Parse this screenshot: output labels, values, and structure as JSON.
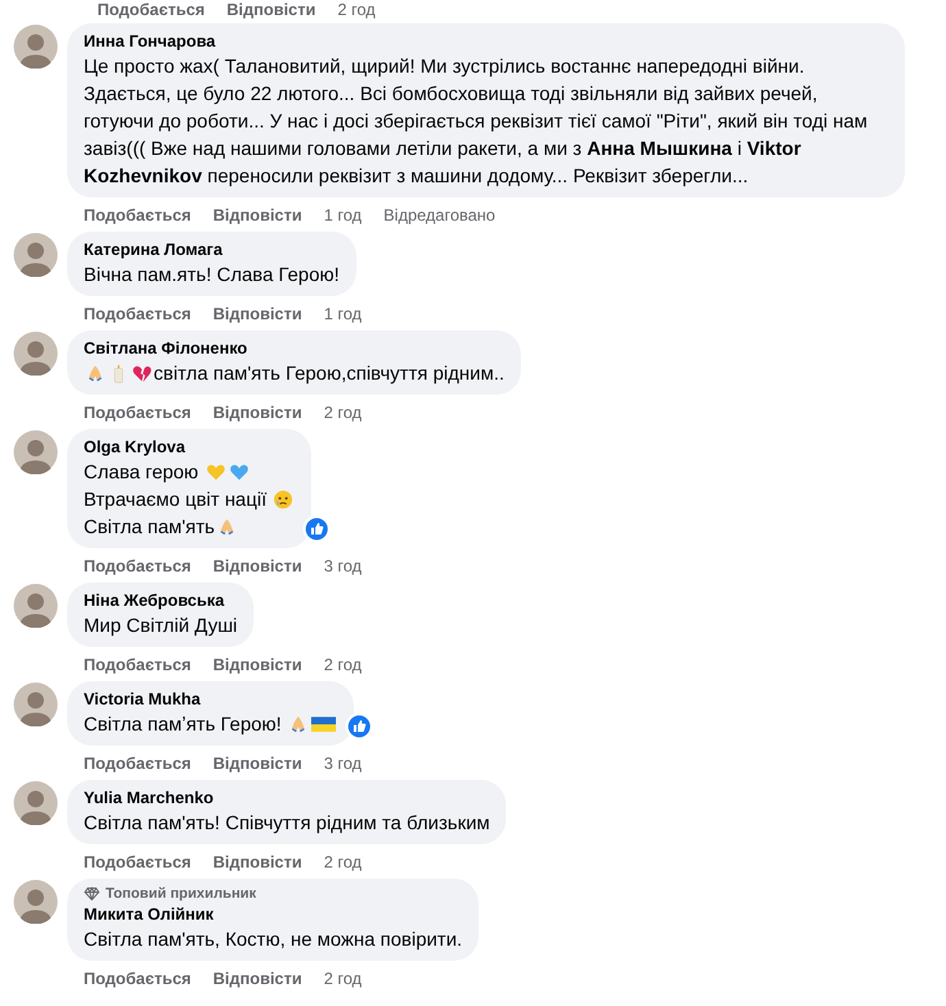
{
  "top_actions": {
    "like": "Подобається",
    "reply": "Відповісти",
    "time": "2 год"
  },
  "comments": [
    {
      "author": "Инна Гончарова",
      "lines": [
        [
          {
            "kind": "text",
            "text": "Це просто жах( Талановитий, щирий! Ми зустрілись востаннє напередодні війни. Здається, це було 22 лютого... Всі бомбосховища тоді звільняли від зайвих речей, готуючи до роботи... У нас і досі зберігається реквізит тієї самої \"Ріти\", який він тоді нам завіз((( Вже над нашими головами летіли ракети, а ми з **Анна Мышкина** і **Viktor Kozhevnikov** переносили реквізит з машини додому... Реквізит зберегли..."
          }
        ]
      ],
      "liked": false,
      "like": "Подобається",
      "reply": "Відповісти",
      "time": "1 год",
      "edited": "Відредаговано"
    },
    {
      "author": "Катерина Ломага",
      "lines": [
        [
          {
            "kind": "text",
            "text": "Вічна пам.ять! Слава Герою!"
          }
        ]
      ],
      "liked": false,
      "like": "Подобається",
      "reply": "Відповісти",
      "time": "1 год"
    },
    {
      "author": "Світлана Філоненко",
      "lines": [
        [
          {
            "kind": "pray"
          },
          {
            "kind": "candle"
          },
          {
            "kind": "broken-heart"
          },
          {
            "kind": "text",
            "text": "світла пам'ять Герою,співчуття рідним.."
          }
        ]
      ],
      "liked": false,
      "like": "Подобається",
      "reply": "Відповісти",
      "time": "2 год"
    },
    {
      "author": "Olga Krylova",
      "lines": [
        [
          {
            "kind": "text",
            "text": "Слава герою "
          },
          {
            "kind": "heart",
            "color": "#f7c325"
          },
          {
            "kind": "heart",
            "color": "#4aa8f0"
          }
        ],
        [
          {
            "kind": "text",
            "text": "Втрачаємо цвіт нації "
          },
          {
            "kind": "sad-face"
          }
        ],
        [
          {
            "kind": "text",
            "text": "Світла пам'ять"
          },
          {
            "kind": "pray"
          }
        ]
      ],
      "liked": true,
      "like": "Подобається",
      "reply": "Відповісти",
      "time": "3 год"
    },
    {
      "author": "Ніна Жебровська",
      "lines": [
        [
          {
            "kind": "text",
            "text": "Мир Світлій Душі"
          }
        ]
      ],
      "liked": false,
      "like": "Подобається",
      "reply": "Відповісти",
      "time": "2 год"
    },
    {
      "author": "Victoria Mukha",
      "lines": [
        [
          {
            "kind": "text",
            "text": "Світла памʼять Герою! "
          },
          {
            "kind": "pray"
          },
          {
            "kind": "flag"
          }
        ]
      ],
      "liked": true,
      "like": "Подобається",
      "reply": "Відповісти",
      "time": "3 год"
    },
    {
      "author": "Yulia Marchenko",
      "lines": [
        [
          {
            "kind": "text",
            "text": "Світла пам'ять! Співчуття рідним та близьким"
          }
        ]
      ],
      "liked": false,
      "like": "Подобається",
      "reply": "Відповісти",
      "time": "2 год"
    },
    {
      "author": "Микита Олійник",
      "badge": "Топовий прихильник",
      "lines": [
        [
          {
            "kind": "text",
            "text": "Світла пам'ять, Костю, не можна повірити."
          }
        ]
      ],
      "liked": false,
      "like": "Подобається",
      "reply": "Відповісти",
      "time": "2 год"
    }
  ]
}
